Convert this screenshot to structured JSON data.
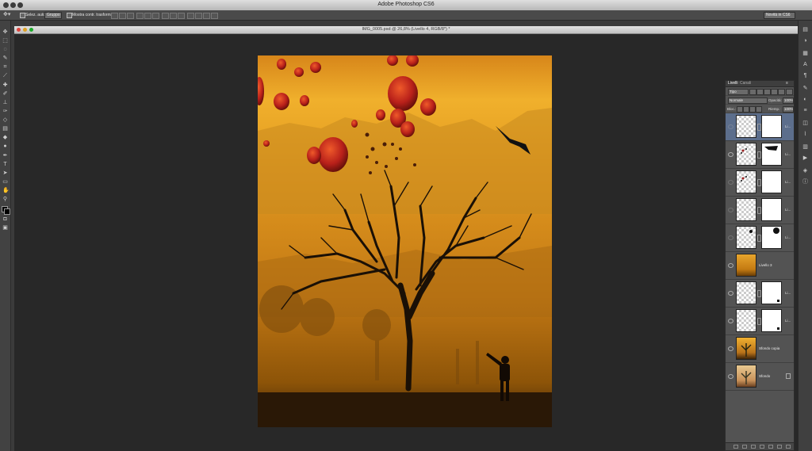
{
  "app": {
    "title": "Adobe Photoshop CS6"
  },
  "options_bar": {
    "auto_select_label": "Selez. auto:",
    "auto_select_value": "Gruppo",
    "show_transform_label": "Mostra contr. trasformaz.",
    "workspace": "Novità in CS6"
  },
  "document": {
    "title": "IMG_0005.psd @ 26,8% (Livello 4, RGB/8*) *"
  },
  "colors": {
    "sky_top": "#e59a1c",
    "sky_mid": "#c07a12",
    "ground": "#2a1806",
    "selected_layer": "#5c6e8c"
  },
  "layers_panel": {
    "tabs": [
      "Livelli",
      "Canali"
    ],
    "filter_kind": "Tipo",
    "blend_mode": "Normale",
    "opacity_label": "Opacità:",
    "opacity_value": "100%",
    "lock_label": "Bloc.:",
    "fill_label": "Riemp.:",
    "fill_value": "100%",
    "layers": [
      {
        "name": "Li...",
        "thumb": "transparent",
        "mask": true,
        "selected": true,
        "eye": false
      },
      {
        "name": "Li...",
        "thumb": "transparent-birds",
        "mask": true,
        "selected": false,
        "eye": true
      },
      {
        "name": "Li...",
        "thumb": "transparent-birds",
        "mask": true,
        "selected": false,
        "eye": false
      },
      {
        "name": "Li...",
        "thumb": "transparent",
        "mask": true,
        "selected": false,
        "eye": false
      },
      {
        "name": "Li...",
        "thumb": "transparent-balloons",
        "mask": true,
        "selected": false,
        "eye": false
      },
      {
        "name": "Livello 3",
        "thumb": "orange",
        "mask": false,
        "selected": false,
        "eye": true
      },
      {
        "name": "Li...",
        "thumb": "transparent",
        "mask": true,
        "selected": false,
        "eye": true
      },
      {
        "name": "Li...",
        "thumb": "transparent",
        "mask": true,
        "selected": false,
        "eye": true
      },
      {
        "name": "Sfondo copia",
        "thumb": "tree",
        "mask": false,
        "selected": false,
        "eye": true
      },
      {
        "name": "Sfondo",
        "thumb": "tree-light",
        "mask": false,
        "selected": false,
        "eye": true,
        "locked": true
      }
    ]
  }
}
